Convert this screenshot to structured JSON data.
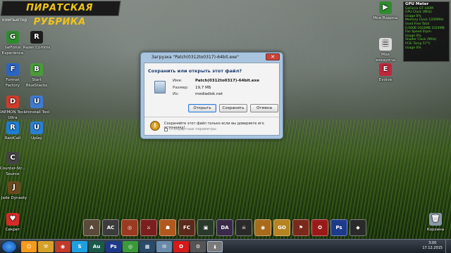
{
  "banner": {
    "text": "ПИРАТСКАЯ РУБРИКА"
  },
  "desktop": {
    "top_label": "компьютер",
    "left_icons": [
      {
        "label": "GeForce Experience",
        "icon": "geforce-icon",
        "color": "#2f8c2f",
        "glyph": "G"
      },
      {
        "label": "Razer Comms",
        "icon": "razer-icon",
        "color": "#1e1e1e",
        "glyph": "R"
      },
      {
        "label": "Format Factory",
        "icon": "format-factory-icon",
        "color": "#2b64c4",
        "glyph": "F"
      },
      {
        "label": "Start BlueStacks",
        "icon": "bluestacks-icon",
        "color": "#4a9b3b",
        "glyph": "B"
      },
      {
        "label": "DAEMON Tools Ultra",
        "icon": "daemon-tools-icon",
        "color": "#d13b2b",
        "glyph": "D"
      },
      {
        "label": "Uninstall Tool",
        "icon": "uninstall-tool-icon",
        "color": "#3f7ad1",
        "glyph": "U"
      },
      {
        "label": "RaidCall",
        "icon": "raidcall-icon",
        "color": "#1e7dd6",
        "glyph": "R"
      },
      {
        "label": "Uplay",
        "icon": "uplay-icon",
        "color": "#2a7fd4",
        "glyph": "U"
      },
      {
        "label": "Counter-Str... Source",
        "icon": "counter-strike-icon",
        "color": "#444444",
        "glyph": "C"
      },
      {
        "label": "Jade Dynasty",
        "icon": "jade-dynasty-icon",
        "color": "#6b4a1e",
        "glyph": "J"
      },
      {
        "label": "Секрет",
        "icon": "heart-icon",
        "color": "#d82a2a",
        "glyph": "♥"
      }
    ],
    "right_icons": [
      {
        "label": "Мои Видосы",
        "icon": "folder-video-icon",
        "color": "#2f8c2f",
        "glyph": "▶"
      },
      {
        "label": "Мои аккаунты",
        "icon": "accounts-icon",
        "color": "#dcdcdc",
        "glyph": "☰"
      },
      {
        "label": "Evolve",
        "icon": "evolve-icon",
        "color": "#c0263b",
        "glyph": "E"
      },
      {
        "label": "Корзина",
        "icon": "recycle-bin-icon",
        "color": "#8a9aa8",
        "glyph": "🗑"
      }
    ]
  },
  "dialog": {
    "title": "Загрузка \"Patch(0312to0317)-64bit.exe\"",
    "close_label": "✕",
    "question": "Сохранить или открыть этот файл?",
    "name_key": "Имя:",
    "name_value": "Patch(0312to0317)-64bit.exe",
    "size_key": "Размер:",
    "size_value": "19,7 МБ",
    "from_key": "Из:",
    "from_value": "mediadisk.net",
    "buttons": {
      "open": "Открыть",
      "save": "Сохранить",
      "cancel": "Отмена"
    },
    "warning": "Сохраняйте этот файл только если вы доверяете его источнику!",
    "checkbox_label": "Стандартные параметры"
  },
  "gpu_meter": {
    "title": "GPU Meter",
    "subtitle": "GeForce GT 440M",
    "lines": [
      "GPU Clock (MHz)",
      "Usage 0%",
      "Memory Clock 1200MHz",
      "Used Free Total",
      "0,000B 1024MB 1024MB",
      "Fan Speed 0rpm",
      "Usage 0%",
      "Shader Clock (MHz)",
      "PCIE Temp 57°C",
      "Usage 0%"
    ]
  },
  "dock": [
    {
      "name": "dock-ark",
      "glyph": "A",
      "color": "#5a4a3a"
    },
    {
      "name": "dock-assassins",
      "glyph": "AC",
      "color": "#3c3c3c"
    },
    {
      "name": "dock-game-3",
      "glyph": "◎",
      "color": "#9a3a20"
    },
    {
      "name": "dock-game-4",
      "glyph": "⚔",
      "color": "#7a1e1e"
    },
    {
      "name": "dock-game-5",
      "glyph": "☗",
      "color": "#b0581e"
    },
    {
      "name": "dock-farcry",
      "glyph": "FC",
      "color": "#5a2a1a"
    },
    {
      "name": "dock-game-7",
      "glyph": "▣",
      "color": "#2a3a2a"
    },
    {
      "name": "dock-dead-or-alive",
      "glyph": "DA",
      "color": "#3a2a4a"
    },
    {
      "name": "dock-game-9",
      "glyph": "☠",
      "color": "#2a2a2a"
    },
    {
      "name": "dock-game-10",
      "glyph": "◉",
      "color": "#a86b1a"
    },
    {
      "name": "dock-csgo",
      "glyph": "GO",
      "color": "#b58320"
    },
    {
      "name": "dock-game-12",
      "glyph": "⚑",
      "color": "#7a2a1a"
    },
    {
      "name": "dock-game-13",
      "glyph": "✪",
      "color": "#9a1a1a"
    },
    {
      "name": "dock-photoshop",
      "glyph": "Ps",
      "color": "#1e3a8a"
    },
    {
      "name": "dock-game-15",
      "glyph": "◆",
      "color": "#2a2a2a"
    }
  ],
  "taskbar": {
    "items": [
      {
        "name": "taskbar-app-1",
        "glyph": "☺",
        "color": "#f59a1a"
      },
      {
        "name": "taskbar-app-2",
        "glyph": "⚒",
        "color": "#d6a12a"
      },
      {
        "name": "taskbar-app-3",
        "glyph": "◉",
        "color": "#c23a2a"
      },
      {
        "name": "taskbar-skype",
        "glyph": "S",
        "color": "#1ea0e0"
      },
      {
        "name": "taskbar-audition",
        "glyph": "Au",
        "color": "#1a5a4a"
      },
      {
        "name": "taskbar-photoshop",
        "glyph": "Ps",
        "color": "#1e3a8a"
      },
      {
        "name": "taskbar-chrome",
        "glyph": "◎",
        "color": "#3a9a3a"
      },
      {
        "name": "taskbar-media",
        "glyph": "▦",
        "color": "#2a4a6a"
      },
      {
        "name": "taskbar-app-9",
        "glyph": "✉",
        "color": "#6a8aaa"
      },
      {
        "name": "taskbar-opera",
        "glyph": "O",
        "color": "#d41a1a"
      },
      {
        "name": "taskbar-app-11",
        "glyph": "⚙",
        "color": "#555555"
      },
      {
        "name": "taskbar-download",
        "glyph": "⬇",
        "color": "#7a7a7a"
      }
    ],
    "time": "3:00",
    "date": "17.12.2015"
  }
}
